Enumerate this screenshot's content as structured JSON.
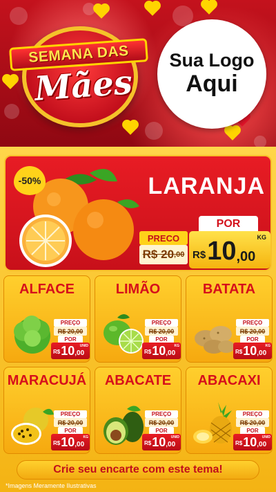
{
  "header": {
    "badge_top": "SEMANA DAS",
    "badge_bottom": "Mães",
    "logo_line1": "Sua Logo",
    "logo_line2": "Aqui"
  },
  "featured": {
    "discount": "-50%",
    "name": "LARANJA",
    "preco_label": "PRECO",
    "old_price_int": "R$ 20",
    "old_price_dec": ",00",
    "por_label": "POR",
    "new_currency": "R$",
    "new_int": "10",
    "new_dec": ",00",
    "unit": "KG"
  },
  "products": [
    {
      "name": "ALFACE",
      "preco_label": "PREÇO",
      "old": "R$ 20,00",
      "por": "POR",
      "cur": "R$",
      "int": "10",
      "dec": ",00",
      "unit": "UNID"
    },
    {
      "name": "LIMÃO",
      "preco_label": "PREÇO",
      "old": "R$ 20,00",
      "por": "POR",
      "cur": "R$",
      "int": "10",
      "dec": ",00",
      "unit": "KG"
    },
    {
      "name": "BATATA",
      "preco_label": "PREÇO",
      "old": "R$ 20,00",
      "por": "POR",
      "cur": "R$",
      "int": "10",
      "dec": ",00",
      "unit": "KG"
    },
    {
      "name": "MARACUJÁ",
      "preco_label": "PREÇO",
      "old": "R$ 20,00",
      "por": "POR",
      "cur": "R$",
      "int": "10",
      "dec": ",00",
      "unit": "KG"
    },
    {
      "name": "ABACATE",
      "preco_label": "PREÇO",
      "old": "R$ 20,00",
      "por": "POR",
      "cur": "R$",
      "int": "10",
      "dec": ",00",
      "unit": "UNID"
    },
    {
      "name": "ABACAXI",
      "preco_label": "PREÇO",
      "old": "R$ 20,00",
      "por": "POR",
      "cur": "R$",
      "int": "10",
      "dec": ",00",
      "unit": "UNID"
    }
  ],
  "footer": {
    "cta": "Crie seu encarte com este tema!",
    "disclaimer": "*Imagens Meramente Ilustrativas"
  },
  "colors": {
    "brand_red": "#d60f1b",
    "brand_yellow": "#ffd12e"
  }
}
